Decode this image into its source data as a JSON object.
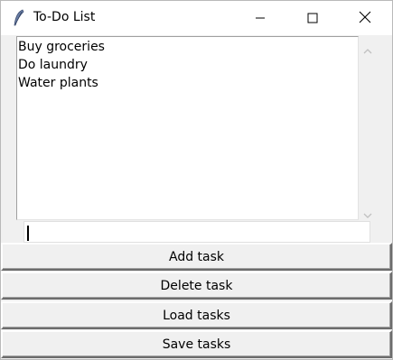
{
  "window": {
    "title": "To-Do List",
    "icons": {
      "app": "feather-icon",
      "minimize": "minimize-icon",
      "maximize": "maximize-icon",
      "close": "close-icon"
    }
  },
  "tasks": [
    "Buy groceries",
    "Do laundry",
    "Water plants"
  ],
  "entry": {
    "value": ""
  },
  "buttons": {
    "add": "Add task",
    "delete": "Delete task",
    "load": "Load tasks",
    "save": "Save tasks"
  },
  "colors": {
    "titlebar": "#ffffff",
    "window_bg": "#f0f0f0",
    "list_bg": "#ffffff"
  }
}
